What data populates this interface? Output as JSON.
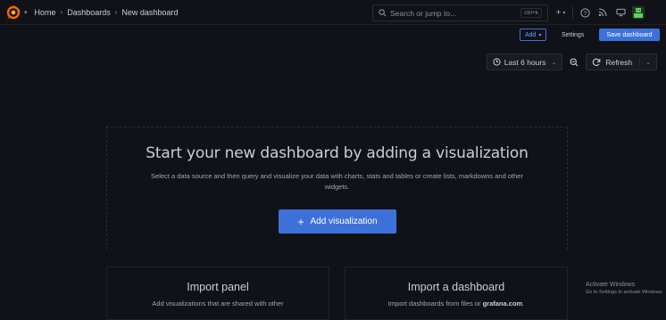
{
  "topbar": {
    "breadcrumbs": [
      "Home",
      "Dashboards",
      "New dashboard"
    ],
    "search": {
      "placeholder": "Search or jump to...",
      "shortcut": "ctrl+k"
    },
    "icons": [
      "plus-icon",
      "help-icon",
      "rss-icon",
      "monitor-icon",
      "avatar"
    ]
  },
  "toolbar": {
    "add_label": "Add",
    "settings_label": "Settings",
    "save_label": "Save dashboard"
  },
  "timebar": {
    "range_label": "Last 6 hours",
    "refresh_label": "Refresh"
  },
  "empty_state": {
    "title": "Start your new dashboard by adding a visualization",
    "subtitle": "Select a data source and then query and visualize your data with charts, stats and tables or create lists, markdowns and other widgets.",
    "button_label": "Add visualization"
  },
  "cards": {
    "import_panel": {
      "title": "Import panel",
      "subtitle": "Add visualizations that are shared with other"
    },
    "import_dashboard": {
      "title": "Import a dashboard",
      "subtitle_prefix": "Import dashboards from files or",
      "subtitle_link": "grafana.com",
      "subtitle_suffix": "."
    }
  },
  "watermark": {
    "line1": "Activate Windows",
    "line2": "Go to Settings to activate Windows."
  },
  "colors": {
    "background": "#111217",
    "primary": "#3d71d9",
    "text": "#ccccdc",
    "muted": "#9fa7b3"
  }
}
